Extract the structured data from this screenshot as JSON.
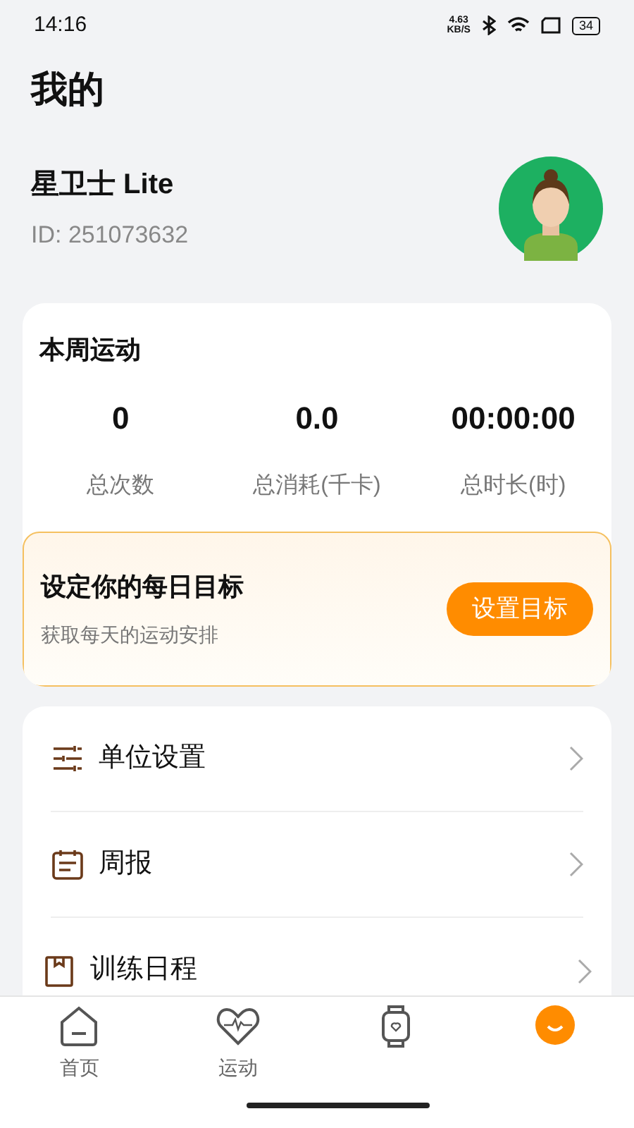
{
  "status_bar": {
    "time": "14:16",
    "speed": "4.63",
    "speed_unit": "KB/S",
    "battery": "34"
  },
  "title": "我的",
  "profile": {
    "name": "星卫士 Lite",
    "id": "ID: 251073632"
  },
  "weekly": {
    "title": "本周运动",
    "stats": [
      {
        "value": "0",
        "label": "总次数"
      },
      {
        "value": "0.0",
        "label": "总消耗(千卡)"
      },
      {
        "value": "00:00:00",
        "label": "总时长(时)"
      }
    ]
  },
  "goal": {
    "title": "设定你的每日目标",
    "subtitle": "获取每天的运动安排",
    "button": "设置目标"
  },
  "menu": [
    {
      "kind": "units",
      "label": "单位设置"
    },
    {
      "kind": "report",
      "label": "周报"
    },
    {
      "kind": "plan",
      "label": "训练日程"
    }
  ],
  "tabs": [
    {
      "kind": "home",
      "label": "首页",
      "selected": false
    },
    {
      "kind": "sport",
      "label": "运动",
      "selected": false
    },
    {
      "kind": "device",
      "selected": false
    },
    {
      "kind": "me",
      "selected": true
    }
  ]
}
